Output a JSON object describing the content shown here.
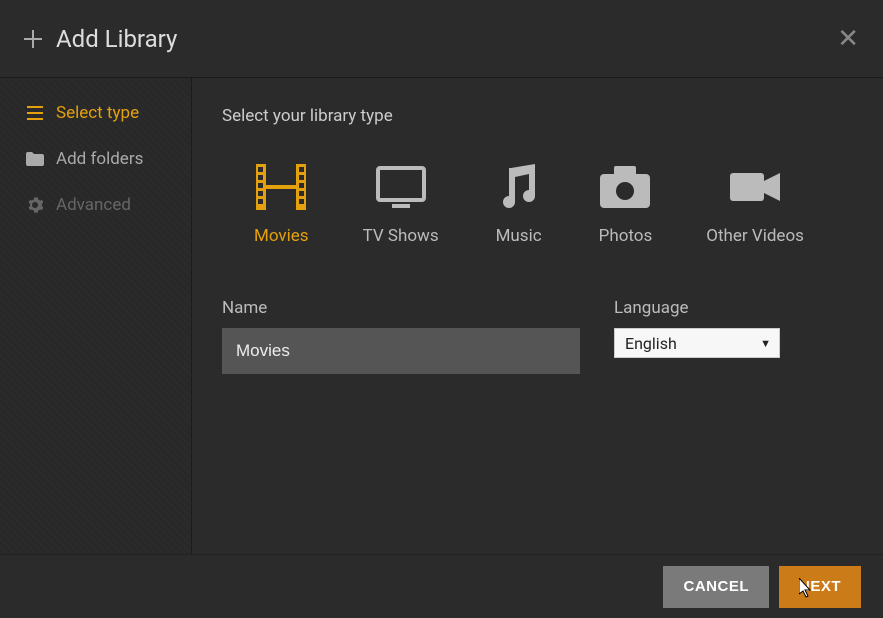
{
  "colors": {
    "accent": "#e5a00d",
    "primaryBtn": "#cc7b19"
  },
  "header": {
    "title": "Add Library"
  },
  "sidebar": {
    "items": [
      {
        "label": "Select type",
        "icon": "list-icon",
        "active": true,
        "disabled": false
      },
      {
        "label": "Add folders",
        "icon": "folder-icon",
        "active": false,
        "disabled": false
      },
      {
        "label": "Advanced",
        "icon": "gear-icon",
        "active": false,
        "disabled": true
      }
    ]
  },
  "main": {
    "sectionTitle": "Select your library type",
    "types": [
      {
        "label": "Movies",
        "icon": "film-icon",
        "active": true
      },
      {
        "label": "TV Shows",
        "icon": "tv-icon",
        "active": false
      },
      {
        "label": "Music",
        "icon": "music-icon",
        "active": false
      },
      {
        "label": "Photos",
        "icon": "camera-icon",
        "active": false
      },
      {
        "label": "Other Videos",
        "icon": "video-icon",
        "active": false
      }
    ],
    "name": {
      "label": "Name",
      "value": "Movies",
      "placeholder": ""
    },
    "language": {
      "label": "Language",
      "value": "English"
    }
  },
  "footer": {
    "cancel": "CANCEL",
    "next": "NEXT"
  }
}
